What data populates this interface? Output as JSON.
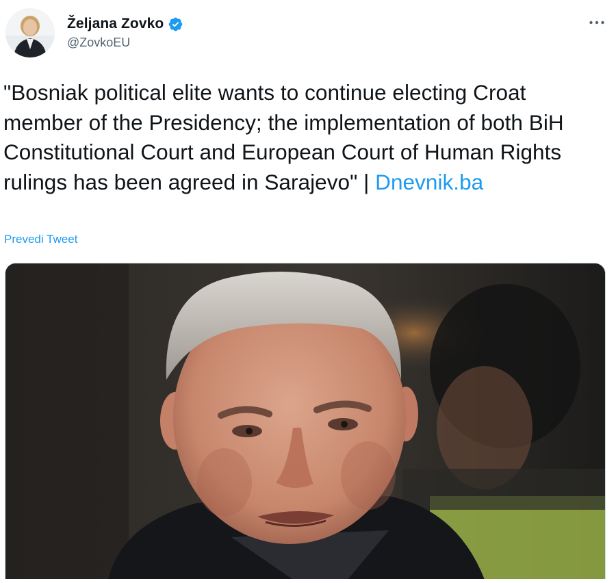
{
  "author": {
    "display_name": "Željana Zovko",
    "handle": "@ZovkoEU",
    "verified": true,
    "avatar_icon": "profile-photo"
  },
  "tweet": {
    "text": "\"Bosniak political elite wants to continue electing Croat member of the Presidency; the implementation of both BiH Constitutional Court and European Court of Human Rights rulings has been agreed in Sarajevo\" | ",
    "link_text": "Dnevnik.ba",
    "translate_label": "Prevedi Tweet"
  },
  "menu": {
    "more_icon": "more-dots-icon"
  },
  "media": {
    "type": "photo",
    "subject": "portrait"
  },
  "colors": {
    "accent": "#1d9bf0",
    "text_primary": "#0f1419",
    "text_secondary": "#536471",
    "verified_badge": "#1d9bf0"
  }
}
